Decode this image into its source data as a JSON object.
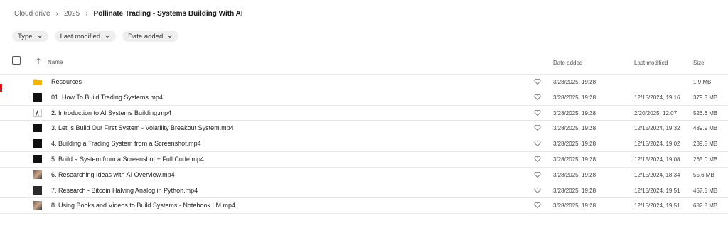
{
  "breadcrumb": {
    "items": [
      {
        "label": "Cloud drive"
      },
      {
        "label": "2025"
      },
      {
        "label": "Pollinate Trading - Systems Building With AI"
      }
    ]
  },
  "filters": [
    {
      "label": "Type"
    },
    {
      "label": "Last modified"
    },
    {
      "label": "Date added"
    }
  ],
  "table": {
    "headers": {
      "name": "Name",
      "date_added": "Date added",
      "last_modified": "Last modified",
      "size": "Size"
    },
    "rows": [
      {
        "name": "Resources",
        "type": "folder",
        "date_added": "3/28/2025, 19:28",
        "last_modified": "",
        "size": "1.9 MB"
      },
      {
        "name": "01. How To Build Trading Systems.mp4",
        "type": "video",
        "date_added": "3/28/2025, 19:28",
        "last_modified": "12/15/2024, 19:16",
        "size": "379.3 MB"
      },
      {
        "name": "2. Introduction to AI Systems Building.mp4",
        "type": "video",
        "date_added": "3/28/2025, 19:28",
        "last_modified": "2/20/2025, 12:07",
        "size": "526.6 MB"
      },
      {
        "name": "3. Let_s Build Our First System - Volatility Breakout System.mp4",
        "type": "video",
        "date_added": "3/28/2025, 19:28",
        "last_modified": "12/15/2024, 19:32",
        "size": "489.9 MB"
      },
      {
        "name": "4. Building a Trading System from a Screenshot.mp4",
        "type": "video",
        "date_added": "3/28/2025, 19:28",
        "last_modified": "12/15/2024, 19:02",
        "size": "239.5 MB"
      },
      {
        "name": "5. Build a System from a Screenshot + Full Code.mp4",
        "type": "video",
        "date_added": "3/28/2025, 19:28",
        "last_modified": "12/15/2024, 19:08",
        "size": "265.0 MB"
      },
      {
        "name": "6. Researching Ideas with AI Overview.mp4",
        "type": "video",
        "date_added": "3/28/2025, 19:28",
        "last_modified": "12/15/2024, 18:34",
        "size": "55.6 MB"
      },
      {
        "name": "7. Research - Bitcoin Halving Analog in Python.mp4",
        "type": "video",
        "date_added": "3/28/2025, 19:28",
        "last_modified": "12/15/2024, 19:51",
        "size": "457.5 MB"
      },
      {
        "name": "8. Using Books and Videos to Build Systems - Notebook LM.mp4",
        "type": "video",
        "date_added": "3/28/2025, 19:28",
        "last_modified": "12/15/2024, 19:51",
        "size": "682.8 MB"
      }
    ]
  },
  "colors": {
    "folder": "#f5b400",
    "accent_mark": "#e01010"
  }
}
